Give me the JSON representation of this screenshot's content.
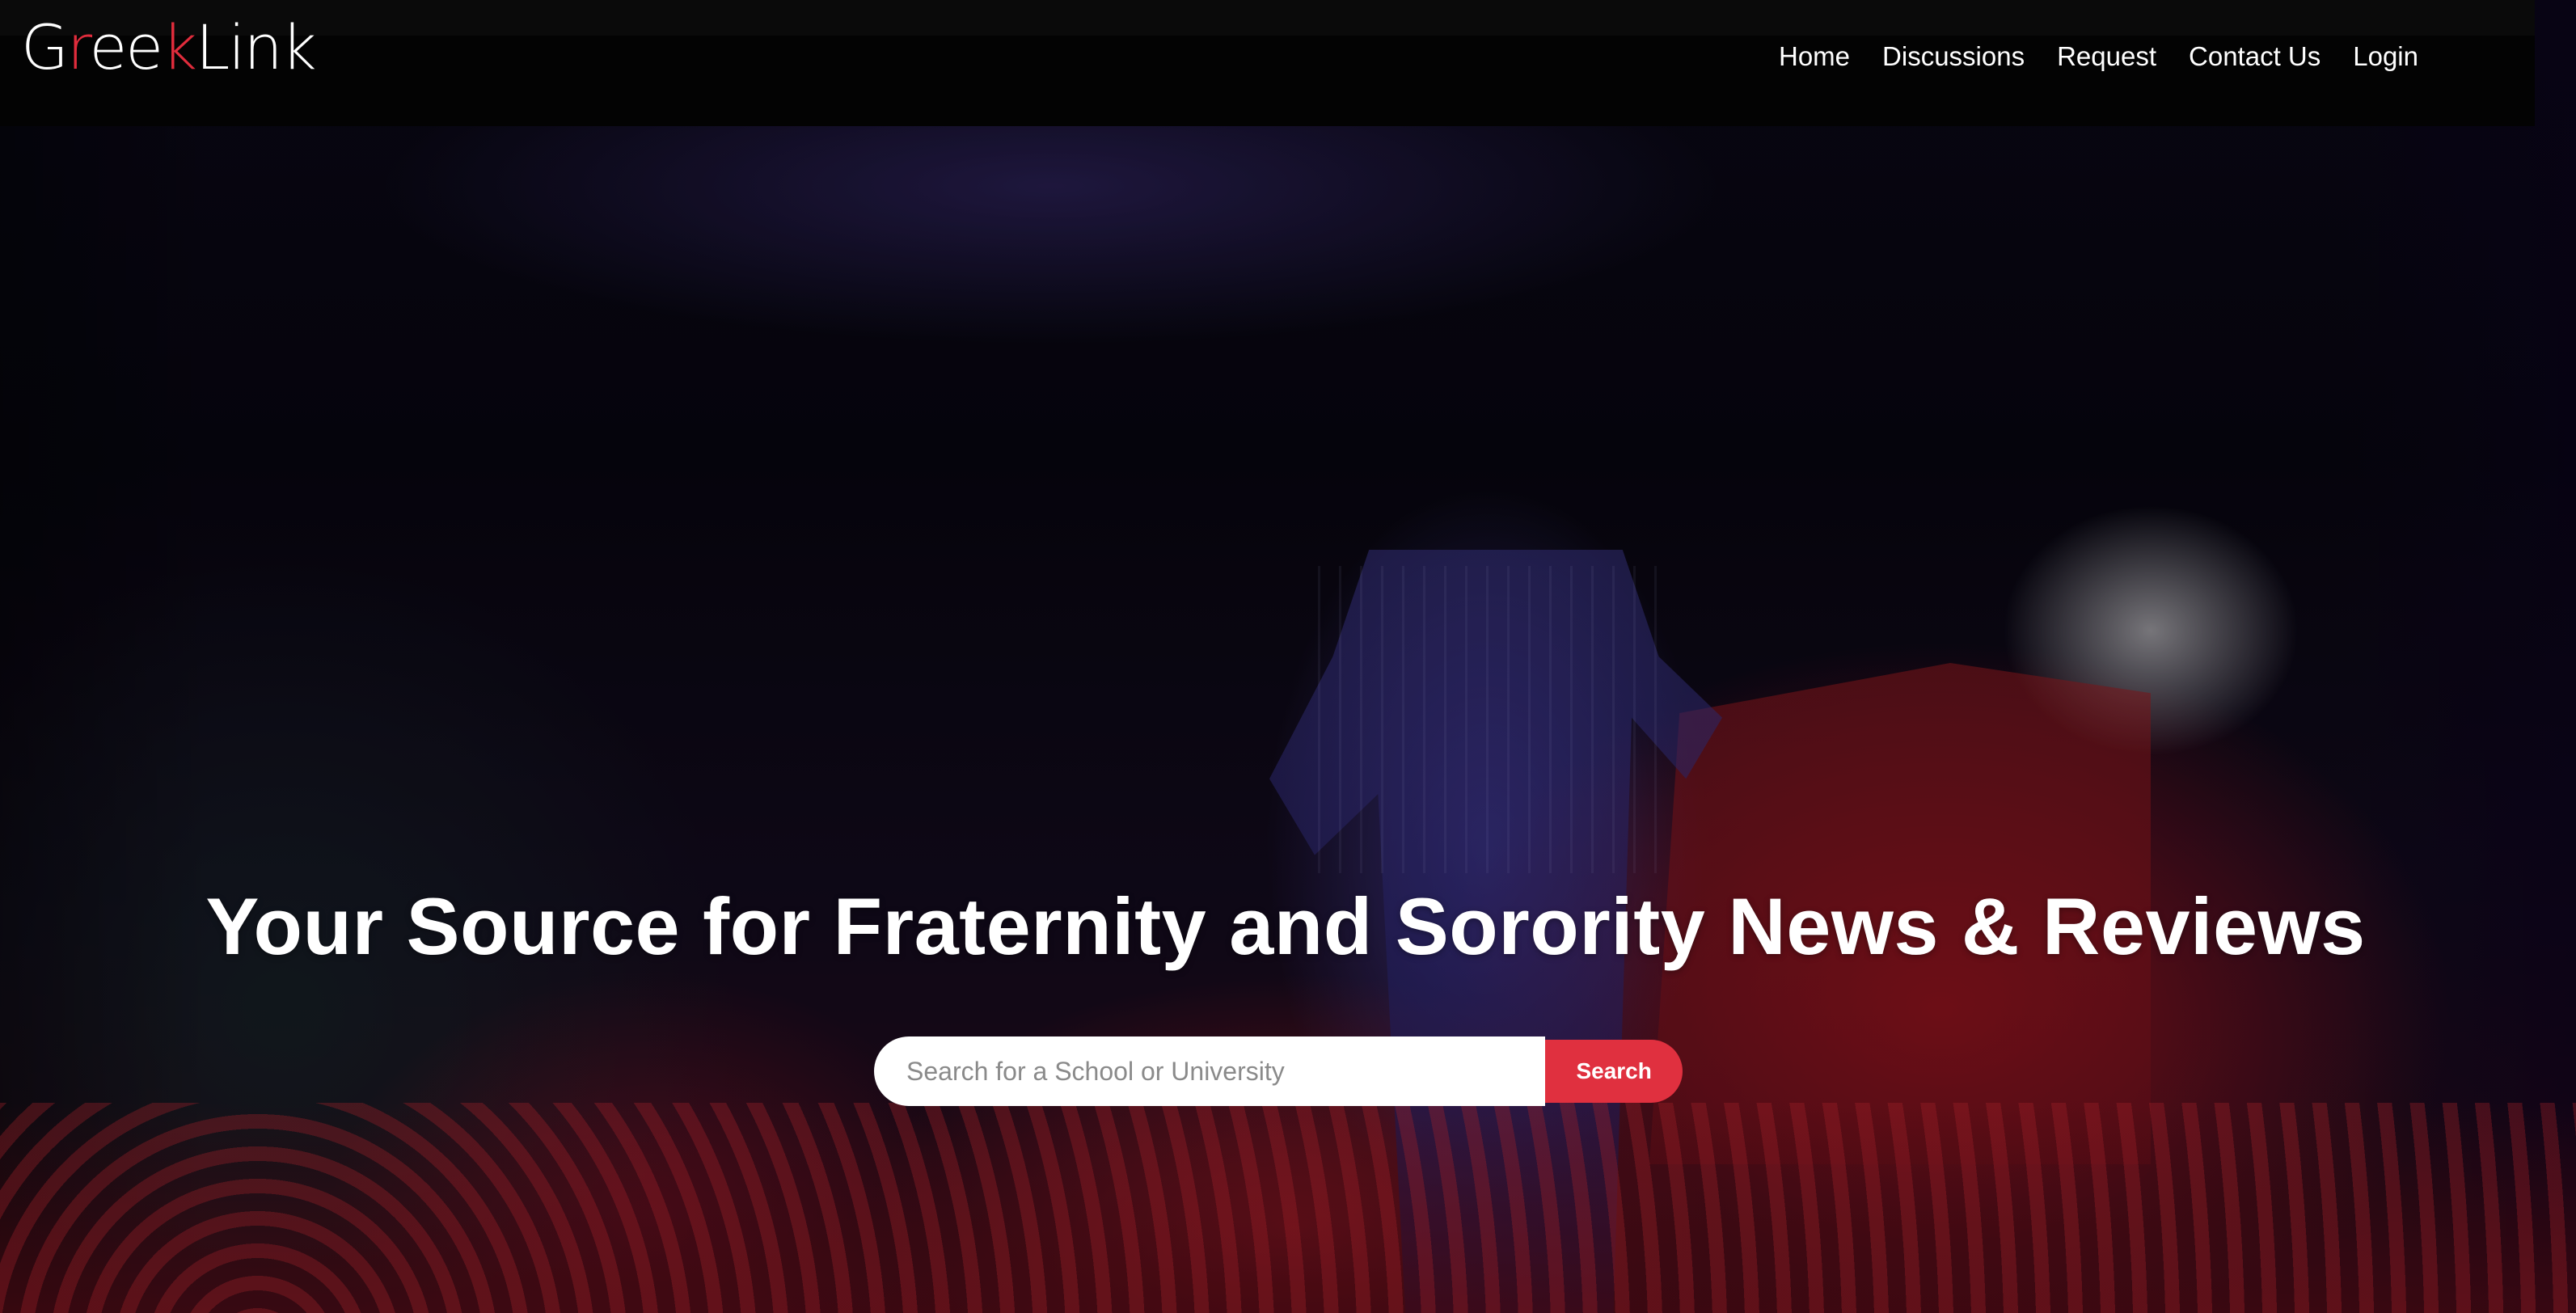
{
  "brand": {
    "logo_parts": [
      {
        "text": "G",
        "color": "#ffffff"
      },
      {
        "text": "r",
        "color": "#e02c3c"
      },
      {
        "text": "ee",
        "color": "#ffffff"
      },
      {
        "text": "k",
        "color": "#e02c3c"
      },
      {
        "text": "Link",
        "color": "#ffffff"
      }
    ]
  },
  "nav": {
    "items": [
      {
        "label": "Home"
      },
      {
        "label": "Discussions"
      },
      {
        "label": "Request"
      },
      {
        "label": "Contact Us"
      },
      {
        "label": "Login"
      }
    ]
  },
  "hero": {
    "title": "Your Source for Fraternity and Sorority News & Reviews",
    "search": {
      "value": "",
      "placeholder": "Search for a School or University",
      "button_label": "Search"
    }
  },
  "colors": {
    "accent": "#e0303f",
    "header_bg": "#030303",
    "text": "#ffffff"
  }
}
